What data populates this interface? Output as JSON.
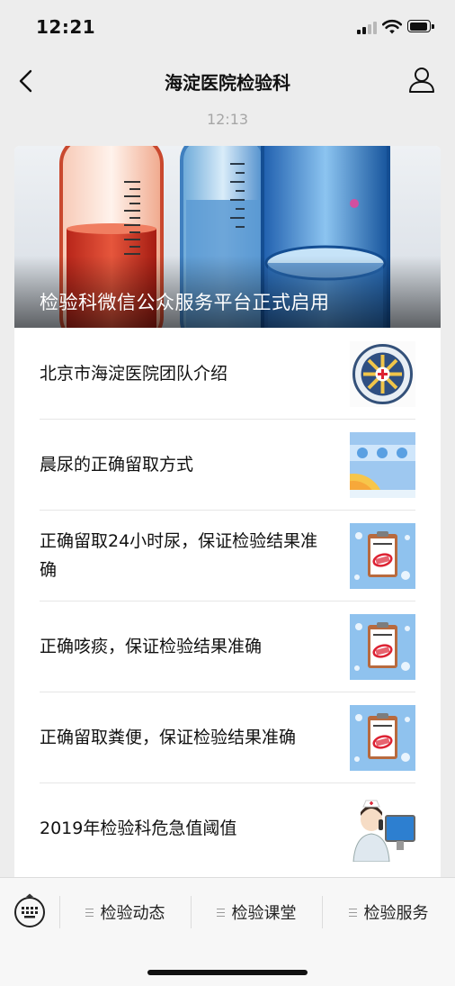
{
  "status_bar": {
    "time": "12:21"
  },
  "nav": {
    "title": "海淀医院检验科"
  },
  "message": {
    "time": "12:13",
    "hero": {
      "title": "检验科微信公众服务平台正式启用"
    },
    "items": [
      {
        "title": "北京市海淀医院团队介绍",
        "thumb": "hospital-emblem"
      },
      {
        "title": "晨尿的正确留取方式",
        "thumb": "sunrise-banner"
      },
      {
        "title": "正确留取24小时尿，保证检验结果准确",
        "thumb": "clipboard-accurate-stamp"
      },
      {
        "title": "正确咳痰，保证检验结果准确",
        "thumb": "clipboard-accurate-stamp"
      },
      {
        "title": "正确留取粪便，保证检验结果准确",
        "thumb": "clipboard-accurate-stamp"
      },
      {
        "title": "2019年检验科危急值阈值",
        "thumb": "nurse-on-phone"
      }
    ]
  },
  "bottom_menu": {
    "tabs": [
      {
        "label": "检验动态"
      },
      {
        "label": "检验课堂"
      },
      {
        "label": "检验服务"
      }
    ]
  }
}
